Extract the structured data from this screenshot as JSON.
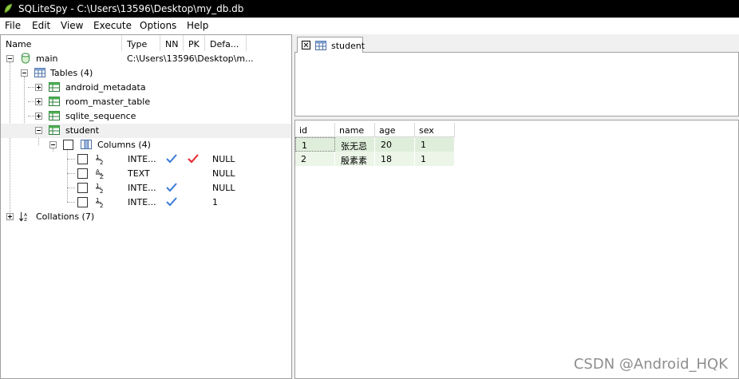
{
  "window": {
    "title": "SQLiteSpy - C:\\Users\\13596\\Desktop\\my_db.db"
  },
  "menu": [
    "File",
    "Edit",
    "View",
    "Execute",
    "Options",
    "Help"
  ],
  "schema": {
    "headers": [
      "Name",
      "Type",
      "NN",
      "PK",
      "Defa..."
    ],
    "db_name": "main",
    "db_path": "C:\\Users\\13596\\Desktop\\m...",
    "tables_label": "Tables (4)",
    "tables": [
      "android_metadata",
      "room_master_table",
      "sqlite_sequence",
      "student"
    ],
    "columns_label": "Columns (4)",
    "columns": [
      {
        "type": "INTE...",
        "nn": true,
        "pk": true,
        "default": "NULL"
      },
      {
        "type": "TEXT",
        "nn": false,
        "pk": false,
        "default": "NULL"
      },
      {
        "type": "INTE...",
        "nn": true,
        "pk": false,
        "default": "NULL"
      },
      {
        "type": "INTE...",
        "nn": true,
        "pk": false,
        "default": "1"
      }
    ],
    "collations_label": "Collations (7)"
  },
  "tab": {
    "label": "student"
  },
  "grid": {
    "columns": [
      "id",
      "name",
      "age",
      "sex"
    ],
    "rows": [
      [
        "1",
        "张无忌",
        "20",
        "1"
      ],
      [
        "2",
        "殷素素",
        "18",
        "1"
      ]
    ]
  },
  "colors": {
    "titlebar": "#000000",
    "nn_check": "#3a7bd5",
    "pk_check": "#e8202a",
    "row_odd": "#dfeedb",
    "row_even": "#ecf6e8"
  },
  "watermark": "CSDN @Android_HQK"
}
